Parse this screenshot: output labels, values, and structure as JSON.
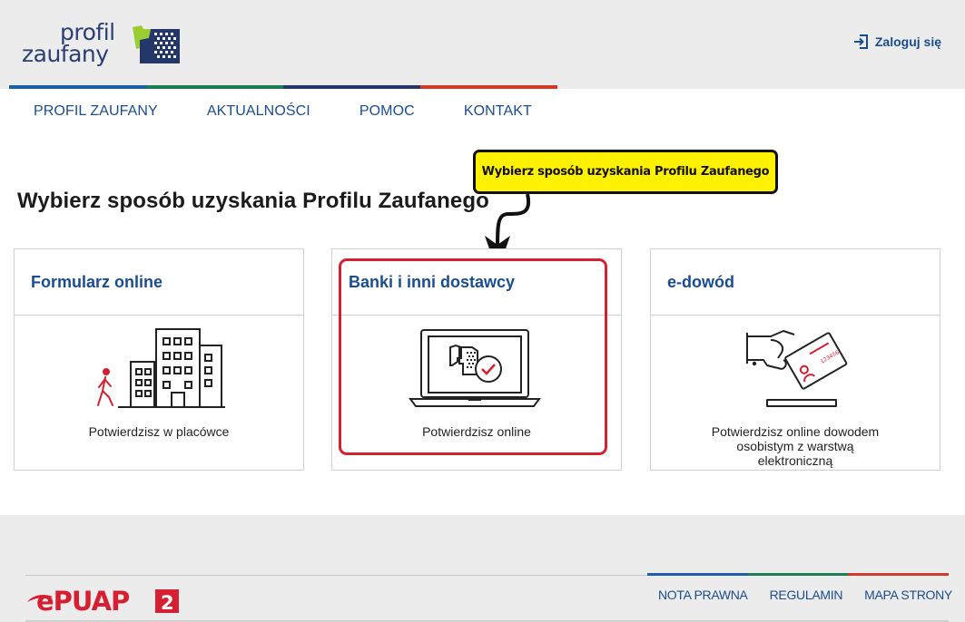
{
  "header": {
    "logo_line1": "profil",
    "logo_line2": "zaufany",
    "login_label": "Zaloguj się",
    "stripe_colors": [
      "#1c5fa8",
      "#1e7c55",
      "#233869",
      "#d03a2a"
    ]
  },
  "nav": {
    "items": [
      "PROFIL ZAUFANY",
      "AKTUALNOŚCI",
      "POMOC",
      "KONTAKT"
    ]
  },
  "main": {
    "title": "Wybierz sposób uzyskania Profilu Zaufanego",
    "callout": "Wybierz sposób uzyskania Profilu Zaufanego",
    "cards": [
      {
        "title": "Formularz online",
        "description": "Potwierdzisz w placówce",
        "icon": "building-icon"
      },
      {
        "title": "Banki i inni dostawcy",
        "description": "Potwierdzisz online",
        "icon": "laptop-icon"
      },
      {
        "title": "e-dowód",
        "description": "Potwierdzisz online dowodem osobistym z warstwą elektroniczną",
        "icon": "id-card-icon"
      }
    ]
  },
  "footer": {
    "brand": "ePUAP",
    "brand_badge": "2",
    "links": [
      "NOTA PRAWNA",
      "REGULAMIN",
      "MAPA STRONY"
    ],
    "stripe_colors": [
      "#1c5fa8",
      "#1e7c55",
      "#d03a2a"
    ]
  },
  "colors": {
    "link": "#1a4d8f",
    "highlight": "#d62031",
    "callout_bg": "#fff200"
  }
}
